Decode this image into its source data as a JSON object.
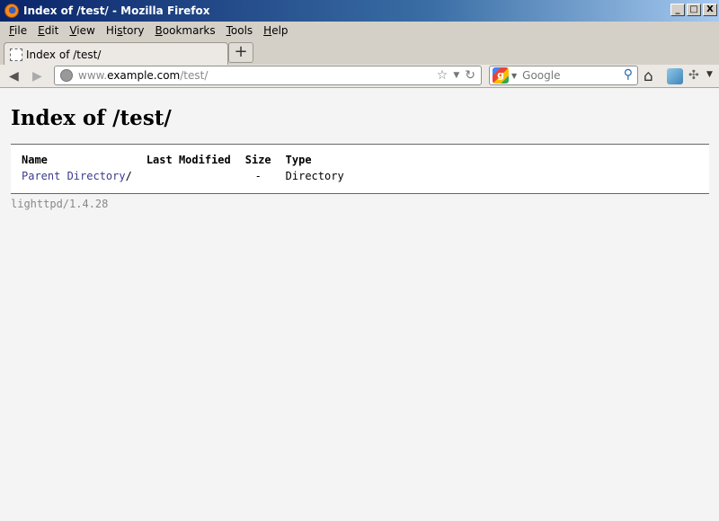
{
  "window": {
    "title": "Index of /test/ - Mozilla Firefox",
    "buttons": {
      "minimize": "_",
      "maximize": "□",
      "close": "X"
    }
  },
  "menubar": {
    "items": [
      {
        "label_u": "F",
        "label_rest": "ile"
      },
      {
        "label_u": "E",
        "label_rest": "dit"
      },
      {
        "label_u": "V",
        "label_rest": "iew"
      },
      {
        "label_pre": "Hi",
        "label_u": "s",
        "label_rest": "tory"
      },
      {
        "label_u": "B",
        "label_rest": "ookmarks"
      },
      {
        "label_u": "T",
        "label_rest": "ools"
      },
      {
        "label_u": "H",
        "label_rest": "elp"
      }
    ]
  },
  "tabs": [
    {
      "label": "Index of /test/",
      "active": true
    }
  ],
  "new_tab_label": "+",
  "navbar": {
    "url_prefix": "www.",
    "url_host": "example.com",
    "url_path": "/test/",
    "search_placeholder": "Google",
    "search_engine_letter": "g"
  },
  "page": {
    "heading": "Index of /test/",
    "columns": [
      "Name",
      "Last Modified",
      "Size",
      "Type"
    ],
    "rows": [
      {
        "name_link": "Parent Directory",
        "name_suffix": "/",
        "modified": "",
        "size": "-",
        "type": "Directory"
      }
    ],
    "footer": "lighttpd/1.4.28"
  },
  "colors": {
    "link": "#3b3b8e",
    "content_bg": "#f4f4f4",
    "titlebar": "#0a246a"
  }
}
